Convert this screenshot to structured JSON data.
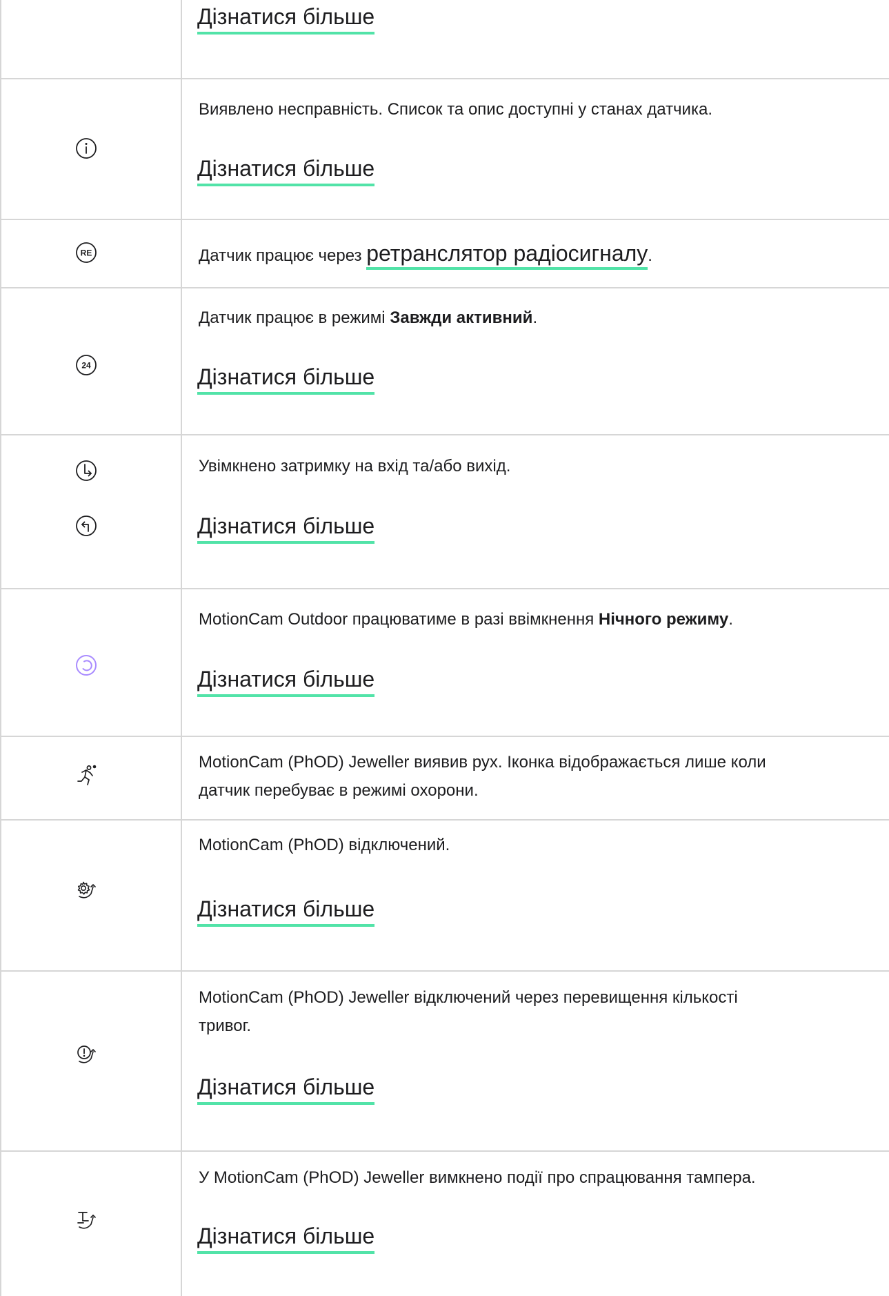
{
  "colors": {
    "link_underline": "#52e3a8",
    "night_mode_icon": "#a98bff",
    "border": "#d6d6d6"
  },
  "rows": [
    {
      "icon": "",
      "text": "",
      "link": "Дізнатися більше"
    },
    {
      "icon": "info-icon",
      "text": "Виявлено несправність. Список та опис доступні у станах датчика.",
      "link": "Дізнатися більше"
    },
    {
      "icon": "re-icon",
      "icon_text": "RE",
      "text_before": "Датчик працює через",
      "text_link": "ретранслятор радіосигналу",
      "text_after": "."
    },
    {
      "icon": "24-icon",
      "icon_text": "24",
      "text_before": "Датчик працює в режимі",
      "text_bold": "Завжди активний",
      "text_after": ".",
      "link": "Дізнатися більше"
    },
    {
      "icons": [
        "entry-delay-icon",
        "exit-delay-icon"
      ],
      "text": "Увімкнено затримку на вхід та/або вихід.",
      "link": "Дізнатися більше"
    },
    {
      "icon": "night-mode-icon",
      "text_before": "MotionCam Outdoor працюватиме в разі ввімкнення",
      "text_bold": "Нічного режиму",
      "text_after": ".",
      "link": "Дізнатися більше"
    },
    {
      "icon": "motion-detected-icon",
      "text_line1": "MotionCam (PhOD) Jeweller виявив рух. Іконка відображається лише коли",
      "text_line2": "датчик перебуває в режимі охорони."
    },
    {
      "icon": "device-disabled-icon",
      "text": "MotionCam (PhOD) відключений.",
      "link": "Дізнатися більше"
    },
    {
      "icon": "alarm-limit-disabled-icon",
      "text_line1": "MotionCam (PhOD) Jeweller відключений через перевищення кількості",
      "text_line2": "тривог.",
      "link": "Дізнатися більше"
    },
    {
      "icon": "tamper-disabled-icon",
      "text": "У MotionCam (PhOD) Jeweller вимкнено події про спрацювання тампера.",
      "link": "Дізнатися більше"
    }
  ]
}
